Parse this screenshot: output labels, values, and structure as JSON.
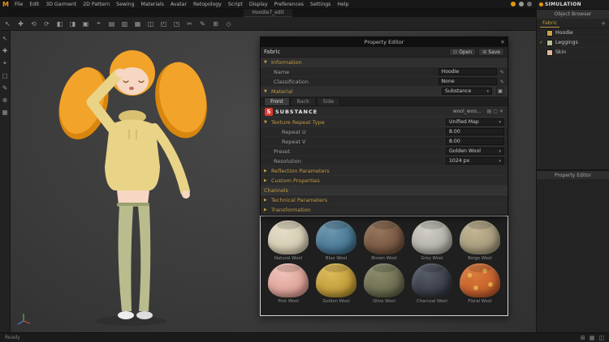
{
  "colors": {
    "logo-orange": "#e8960f",
    "accent-gold": "#c29b45",
    "substance-red": "#e03a2f",
    "hair": "#f2a32a",
    "hair-shade": "#d8860e",
    "hoodie": "#e9d387",
    "hoodie-shade": "#d9c070",
    "leggings": "#b9bd8e",
    "skin": "#f6d7c3",
    "shoe": "#ededed"
  },
  "icons": {
    "close": "✕",
    "dropdown": "▾",
    "expanded": "▼",
    "collapsed": "▶",
    "pencil": "✎",
    "check": "✓",
    "plus": "+",
    "open": "⊡",
    "save": "⊞",
    "panel": "▣"
  },
  "menubar": {
    "logo": "M",
    "items": [
      "File",
      "Edit",
      "3D Garment",
      "2D Pattern",
      "Sewing",
      "Materials",
      "Avatar",
      "Retopology",
      "Script",
      "Display",
      "Preferences",
      "Settings",
      "Help"
    ],
    "right_icons": [
      {
        "color": "#e8960f"
      },
      {
        "color": "#9a9a9a"
      },
      {
        "color": "#6f6f6f"
      }
    ]
  },
  "titlebar": {
    "title": "Hoodie7_edit"
  },
  "toolbar": {
    "icons": [
      "↖",
      "✚",
      "⟲",
      "⟳",
      "◧",
      "◨",
      "▣",
      "⌖",
      "▤",
      "▥",
      "▦",
      "◫",
      "◰",
      "◳",
      "✂",
      "✎",
      "⊞",
      "◇"
    ]
  },
  "side_toolbar": {
    "icons": [
      "↖",
      "✚",
      "⌖",
      "▢",
      "✎",
      "⊕",
      "▦"
    ]
  },
  "property_editor": {
    "title": "Property Editor",
    "fabric": {
      "label": "Fabric",
      "open": "Open",
      "save": "Save"
    },
    "information": {
      "header": "Information",
      "name_label": "Name",
      "name_value": "Hoodie",
      "class_label": "Classification",
      "class_value": "None"
    },
    "material": {
      "header": "Material",
      "type": "Substance",
      "tabs": [
        {
          "label": "Front",
          "active": true
        },
        {
          "label": "Back"
        },
        {
          "label": "Side"
        }
      ],
      "brand_letter": "S",
      "brand": "SUBSTANCE",
      "file": "wool_woo...",
      "brand_buttons": [
        "▤",
        "▢",
        "✕"
      ],
      "texture_repeat_label": "Texture Repeat Type",
      "texture_repeat_value": "Unified Map",
      "repeat_u_label": "Repeat U",
      "repeat_u_value": "8.00",
      "repeat_v_label": "Repeat V",
      "repeat_v_value": "8.00",
      "preset_label": "Preset",
      "preset_value": "Golden Wool",
      "resolution_label": "Resolution",
      "resolution_value": "1024 px",
      "reflection_header": "Reflection Parameters",
      "custom_header": "Custom Properties",
      "channels_header": "Channels",
      "technical_header": "Technical Parameters",
      "transformation_header": "Transformation"
    }
  },
  "materials": {
    "items": [
      {
        "name": "Natural Wool",
        "color": "#cfc6ad",
        "color2": "#e6ddc7"
      },
      {
        "name": "Blue Wool",
        "color": "#3f6e8c",
        "color2": "#6d97b0"
      },
      {
        "name": "Brown Wool",
        "color": "#6e4f3a",
        "color2": "#96755c"
      },
      {
        "name": "Grey Wool",
        "color": "#a9a7a0",
        "color2": "#d0cec7"
      },
      {
        "name": "Beige Wool",
        "color": "#9d9275",
        "color2": "#c2b694"
      },
      {
        "name": "Pink Wool",
        "color": "#d99a90",
        "color2": "#eec2b8"
      },
      {
        "name": "Golden Wool",
        "color": "#b8922f",
        "color2": "#dcbb5a"
      },
      {
        "name": "Olive Wool",
        "color": "#64644a",
        "color2": "#8a8a6a"
      },
      {
        "name": "Charcoal Wool",
        "color": "#32363f",
        "color2": "#565b68"
      },
      {
        "name": "Floral Wool",
        "color": "#bf5a2a",
        "color2": "#e8b14a",
        "pattern": true
      }
    ]
  },
  "sidebar": {
    "mode": "SIMULATION",
    "object_browser": {
      "title": "Object Browser",
      "tab": "Fabric",
      "items": [
        {
          "name": "Hoodie",
          "color": "#c9a34e"
        },
        {
          "name": "Leggings",
          "color": "#b9bd8e",
          "checked": true
        },
        {
          "name": "Skin",
          "color": "#e0b89a"
        }
      ]
    },
    "property_editor_title": "Property Editor"
  },
  "statusbar": {
    "message": "Ready",
    "icons": [
      "⊞",
      "▦",
      "◫"
    ]
  }
}
